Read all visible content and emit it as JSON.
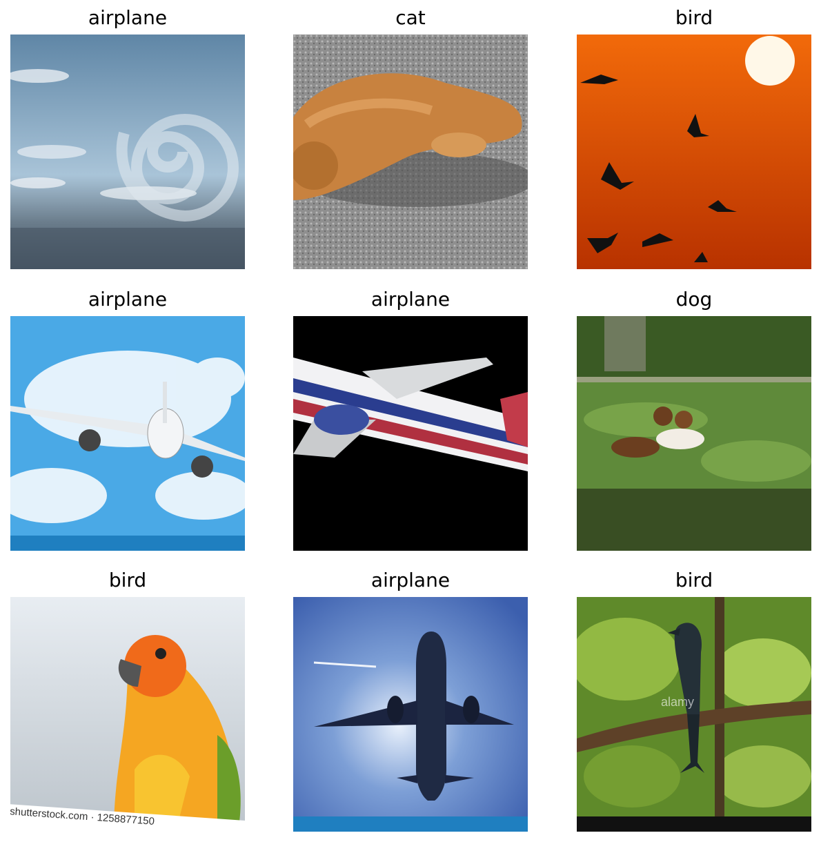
{
  "grid": {
    "items": [
      {
        "label": "airplane"
      },
      {
        "label": "cat"
      },
      {
        "label": "bird"
      },
      {
        "label": "airplane"
      },
      {
        "label": "airplane"
      },
      {
        "label": "dog"
      },
      {
        "label": "bird"
      },
      {
        "label": "airplane"
      },
      {
        "label": "bird"
      }
    ]
  },
  "watermarks": {
    "shutterstock": "shutterstock.com · 1258877150",
    "alamy": "alamy"
  }
}
